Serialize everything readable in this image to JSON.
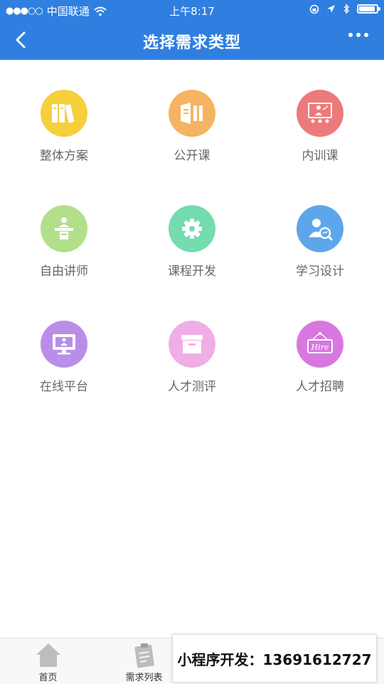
{
  "status_bar": {
    "carrier": "中国联通",
    "time": "上午8:17"
  },
  "nav": {
    "title": "选择需求类型"
  },
  "grid": [
    {
      "label": "整体方案",
      "color": "#f5cf3c",
      "icon": "books-icon"
    },
    {
      "label": "公开课",
      "color": "#f5b462",
      "icon": "open-course-icon"
    },
    {
      "label": "内训课",
      "color": "#ec7a7a",
      "icon": "training-board-icon"
    },
    {
      "label": "自由讲师",
      "color": "#b2df8a",
      "icon": "lecturer-podium-icon"
    },
    {
      "label": "课程开发",
      "color": "#74dcae",
      "icon": "gear-icon"
    },
    {
      "label": "学习设计",
      "color": "#5ea6ea",
      "icon": "user-search-icon"
    },
    {
      "label": "在线平台",
      "color": "#b98ee8",
      "icon": "monitor-icon"
    },
    {
      "label": "人才测评",
      "color": "#efaee6",
      "icon": "archive-box-icon"
    },
    {
      "label": "人才招聘",
      "color": "#d877e0",
      "icon": "hire-sign-icon"
    }
  ],
  "tabbar": [
    {
      "label": "首页",
      "icon": "home-icon"
    },
    {
      "label": "需求列表",
      "icon": "clipboard-icon"
    }
  ],
  "banner": {
    "text": "小程序开发：13691612727"
  },
  "hire_text": "Hire"
}
